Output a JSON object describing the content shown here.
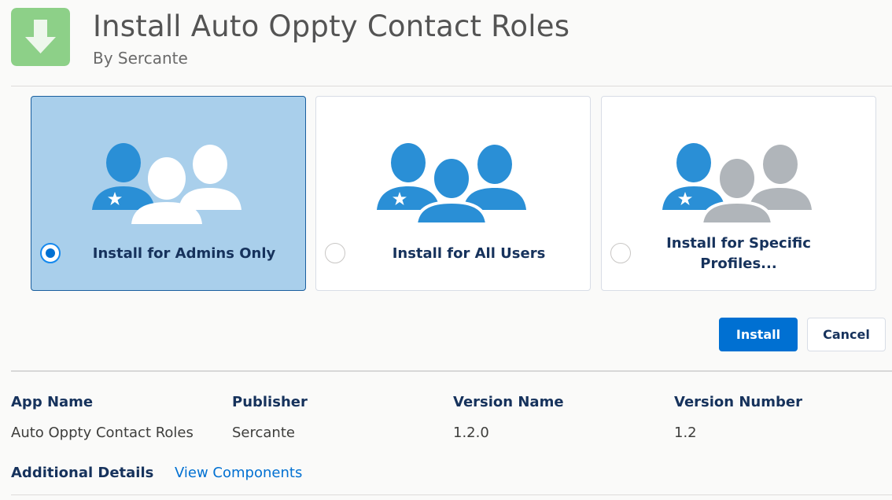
{
  "header": {
    "title": "Install Auto Oppty Contact Roles",
    "subtitle": "By Sercante",
    "icon": "download-arrow-icon",
    "icon_color": "#8dd088"
  },
  "options": [
    {
      "label": "Install for Admins Only",
      "selected": true,
      "icon": "admins-only-people-icon"
    },
    {
      "label": "Install for All Users",
      "selected": false,
      "icon": "all-users-people-icon"
    },
    {
      "label": "Install for Specific Profiles...",
      "selected": false,
      "icon": "specific-profiles-people-icon"
    }
  ],
  "colors": {
    "selected_card": "#a9cfeb",
    "person_blue": "#2a8fd6",
    "person_gray": "#b0b5ba",
    "primary_button": "#0070d2"
  },
  "actions": {
    "install_label": "Install",
    "cancel_label": "Cancel"
  },
  "details": {
    "columns": [
      {
        "header": "App Name",
        "value": "Auto Oppty Contact Roles"
      },
      {
        "header": "Publisher",
        "value": "Sercante"
      },
      {
        "header": "Version Name",
        "value": "1.2.0"
      },
      {
        "header": "Version Number",
        "value": "1.2"
      }
    ],
    "additional_label": "Additional Details",
    "view_components_label": "View Components"
  }
}
